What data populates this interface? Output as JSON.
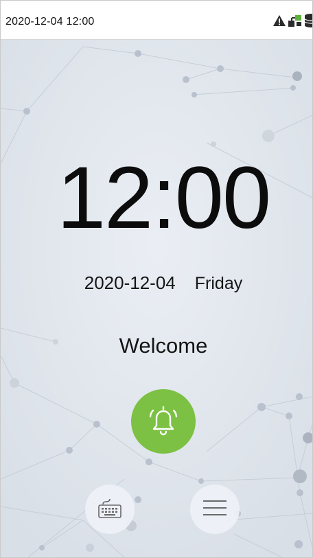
{
  "status_bar": {
    "datetime": "2020-12-04 12:00",
    "icons": [
      "warning-icon",
      "network-icon",
      "database-icon"
    ]
  },
  "clock": {
    "time": "12:00",
    "date": "2020-12-04",
    "weekday": "Friday"
  },
  "welcome_text": "Welcome",
  "buttons": {
    "alarm": "bell-icon",
    "keyboard": "keyboard-icon",
    "menu": "menu-icon"
  },
  "colors": {
    "alarm_green": "#7cc143",
    "background": "#e2e7ee"
  }
}
